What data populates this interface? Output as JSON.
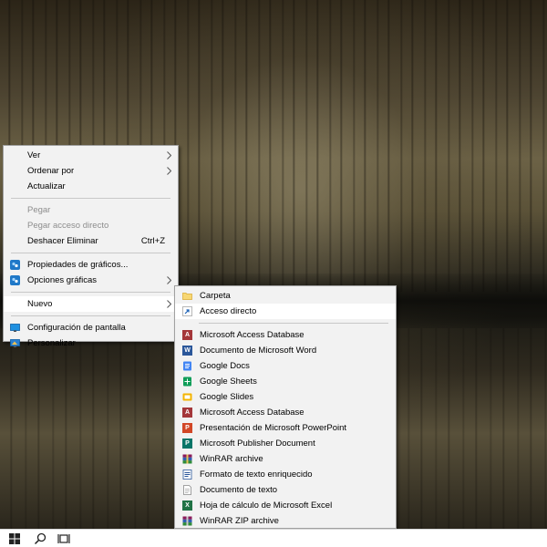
{
  "context_menu": {
    "items": [
      {
        "label": "Ver",
        "submenu": true
      },
      {
        "label": "Ordenar por",
        "submenu": true
      },
      {
        "label": "Actualizar"
      },
      {
        "label": "Pegar",
        "disabled": true
      },
      {
        "label": "Pegar acceso directo",
        "disabled": true
      },
      {
        "label": "Deshacer Eliminar",
        "shortcut": "Ctrl+Z"
      },
      {
        "label": "Propiedades de gráficos...",
        "icon": "intel-graphics-icon"
      },
      {
        "label": "Opciones gráficas",
        "icon": "intel-graphics-icon",
        "submenu": true
      },
      {
        "label": "Nuevo",
        "submenu": true,
        "highlighted": true
      },
      {
        "label": "Configuración de pantalla",
        "icon": "display-settings-icon"
      },
      {
        "label": "Personalizar",
        "icon": "personalize-icon"
      }
    ]
  },
  "new_submenu": {
    "items": [
      {
        "label": "Carpeta",
        "icon": "folder-icon"
      },
      {
        "label": "Acceso directo",
        "icon": "shortcut-icon",
        "highlighted": true
      },
      {
        "label": "Microsoft Access Database",
        "icon": "access-icon"
      },
      {
        "label": "Documento de Microsoft Word",
        "icon": "word-icon"
      },
      {
        "label": "Google Docs",
        "icon": "google-docs-icon"
      },
      {
        "label": "Google Sheets",
        "icon": "google-sheets-icon"
      },
      {
        "label": "Google Slides",
        "icon": "google-slides-icon"
      },
      {
        "label": "Microsoft Access Database",
        "icon": "access-icon"
      },
      {
        "label": "Presentación de Microsoft PowerPoint",
        "icon": "powerpoint-icon"
      },
      {
        "label": "Microsoft Publisher Document",
        "icon": "publisher-icon"
      },
      {
        "label": "WinRAR archive",
        "icon": "winrar-icon"
      },
      {
        "label": "Formato de texto enriquecido",
        "icon": "rtf-icon"
      },
      {
        "label": "Documento de texto",
        "icon": "text-document-icon"
      },
      {
        "label": "Hoja de cálculo de Microsoft Excel",
        "icon": "excel-icon"
      },
      {
        "label": "WinRAR ZIP archive",
        "icon": "winrar-zip-icon"
      }
    ]
  },
  "taskbar": {
    "icons": [
      "windows-start-icon",
      "search-icon",
      "task-view-icon"
    ]
  },
  "colors": {
    "menu_bg": "#f2f2f2",
    "highlight": "#ffffff",
    "disabled_text": "#8d8d8d",
    "word_blue": "#2b579a",
    "excel_green": "#217346",
    "powerpoint_red": "#d24726",
    "access_red": "#a4373a",
    "publisher_teal": "#077568",
    "google_docs_blue": "#4285f4",
    "google_sheets_green": "#0f9d58",
    "google_slides_yellow": "#f4b400"
  }
}
